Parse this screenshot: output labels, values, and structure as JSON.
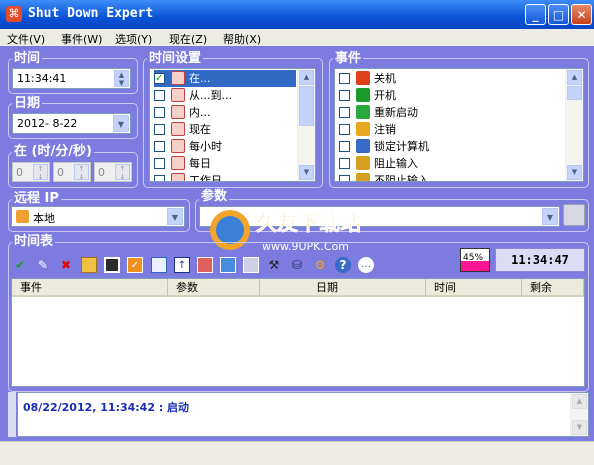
{
  "window": {
    "title": "Shut Down Expert",
    "minimize": "_",
    "maximize": "□",
    "close": "✕"
  },
  "menu": [
    "文件(V)",
    "事件(W)",
    "选项(Y)",
    "现在(Z)",
    "帮助(X)"
  ],
  "time_group": {
    "label": "时间",
    "value": "11:34:41"
  },
  "date_group": {
    "label": "日期",
    "value": "2012- 8-22"
  },
  "at_group": {
    "label": "在 (时/分/秒)",
    "fields": [
      "0",
      "0",
      "0"
    ]
  },
  "time_settings": {
    "label": "时间设置",
    "items": [
      {
        "label": "在...",
        "checked": true,
        "selected": true
      },
      {
        "label": "从...到...",
        "checked": false
      },
      {
        "label": "内...",
        "checked": false
      },
      {
        "label": "现在",
        "checked": false
      },
      {
        "label": "每小时",
        "checked": false
      },
      {
        "label": "每日",
        "checked": false
      },
      {
        "label": "工作日",
        "checked": false
      }
    ]
  },
  "events": {
    "label": "事件",
    "items": [
      {
        "label": "关机",
        "icon": "power-off-icon",
        "color": "#e0401c"
      },
      {
        "label": "开机",
        "icon": "power-on-icon",
        "color": "#1a9a2a"
      },
      {
        "label": "重新启动",
        "icon": "restart-icon",
        "color": "#26a83a"
      },
      {
        "label": "注销",
        "icon": "logoff-icon",
        "color": "#e8a820"
      },
      {
        "label": "锁定计算机",
        "icon": "lock-computer-icon",
        "color": "#3a6ac8"
      },
      {
        "label": "阻止输入",
        "icon": "block-input-icon",
        "color": "#d8a020"
      },
      {
        "label": "不阻止输入",
        "icon": "unblock-input-icon",
        "color": "#d8a020"
      }
    ]
  },
  "remote_ip": {
    "label": "远程 IP",
    "value": "本地"
  },
  "params": {
    "label": "参数",
    "value": ""
  },
  "schedule": {
    "label": "时间表",
    "progress_text": "45%",
    "clock": "11:34:47",
    "columns": [
      "事件",
      "参数",
      "日期",
      "时间",
      "剩余"
    ]
  },
  "toolbar_icons": [
    "check-icon",
    "edit-icon",
    "delete-icon",
    "open-folder-icon",
    "save-icon",
    "task-icon",
    "import-icon",
    "export-icon",
    "copy-icon",
    "keyboard-icon",
    "settings-icon",
    "tools-icon",
    "network-icon",
    "gear-icon",
    "help-icon",
    "chat-icon"
  ],
  "log": {
    "text": "08/22/2012, 11:34:42 : 启动"
  },
  "watermark": {
    "title": "久友下载站",
    "subtitle": "www.9UPK.Com"
  }
}
